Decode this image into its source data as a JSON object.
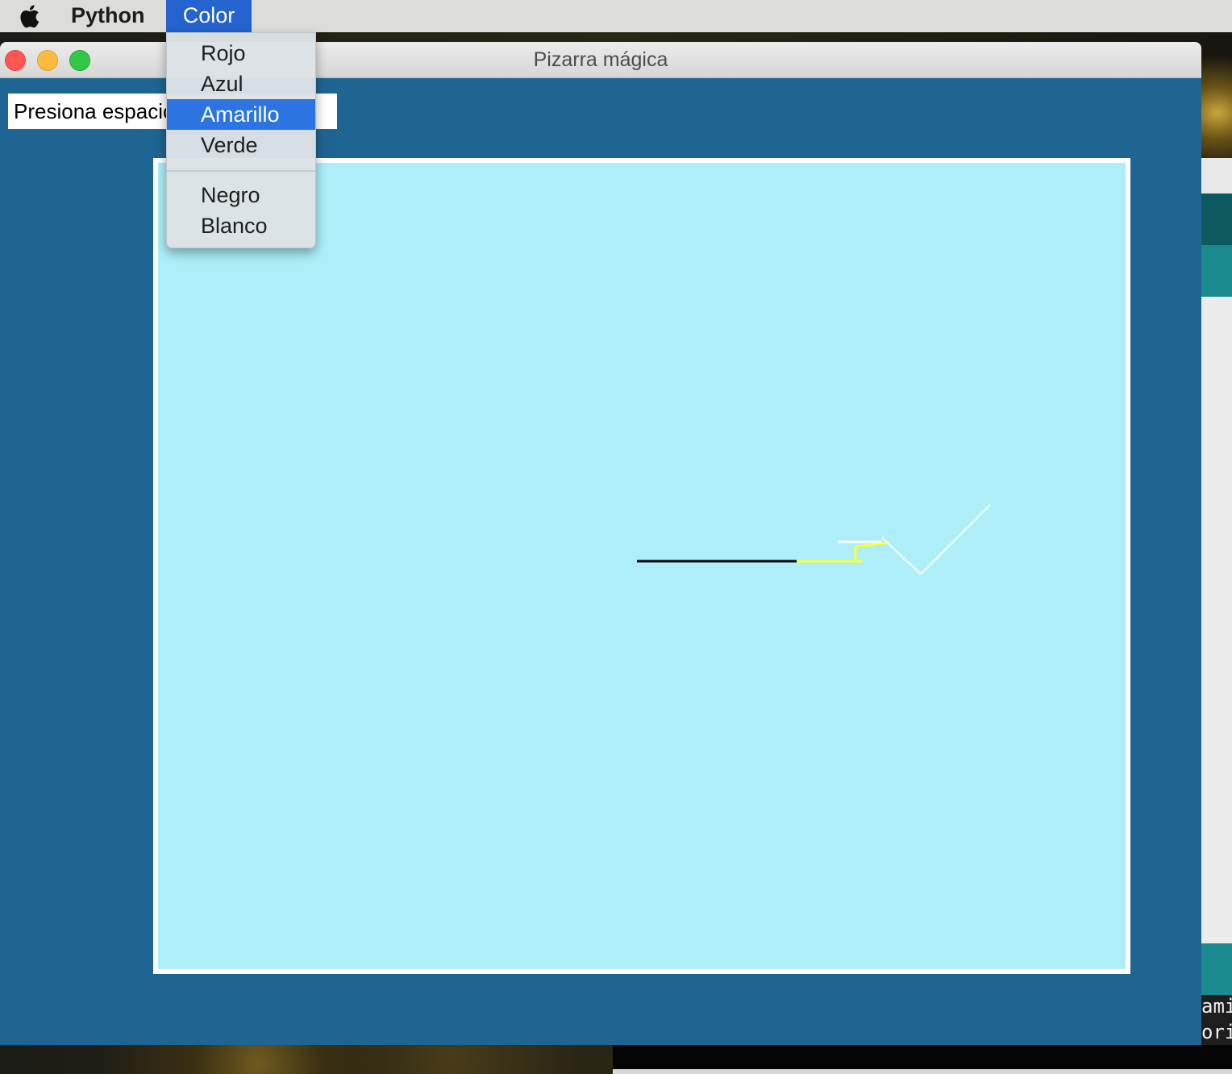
{
  "menubar": {
    "app_name": "Python",
    "active_menu": "Color"
  },
  "window": {
    "title": "Pizarra mágica",
    "hint_text": "Presiona espacio para borrar"
  },
  "color_menu": {
    "items": [
      {
        "label": "Rojo",
        "selected": false
      },
      {
        "label": "Azul",
        "selected": false
      },
      {
        "label": "Amarillo",
        "selected": true
      },
      {
        "label": "Verde",
        "selected": false
      },
      {
        "label": "Negro",
        "selected": false
      },
      {
        "label": "Blanco",
        "selected": false
      }
    ]
  },
  "canvas": {
    "background_color": "#adeef8",
    "stroke_colors": [
      "#000000",
      "#ffff33",
      "#ffffff"
    ]
  },
  "background_terminal": {
    "lines": [
      "ami",
      "ori"
    ]
  },
  "colors": {
    "window_bg": "#1f6593",
    "menu_highlight": "#2b74e2",
    "menubar_active": "#2563cf"
  }
}
